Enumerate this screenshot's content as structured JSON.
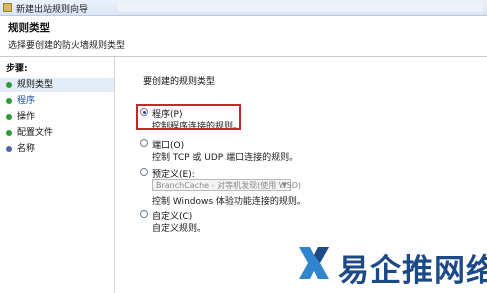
{
  "window": {
    "title": "新建出站规则向导"
  },
  "header": {
    "title": "规则类型",
    "subtitle": "选择要创建的防火墙规则类型"
  },
  "sidebar": {
    "steps_label": "步骤:",
    "items": [
      {
        "label": "规则类型"
      },
      {
        "label": "程序"
      },
      {
        "label": "操作"
      },
      {
        "label": "配置文件"
      },
      {
        "label": "名称"
      }
    ]
  },
  "main": {
    "prompt": "要创建的规则类型",
    "options": [
      {
        "label": "程序(P)",
        "description": "控制程序连接的规则。",
        "selected": true
      },
      {
        "label": "端口(O)",
        "description": "控制 TCP 或 UDP 端口连接的规则。",
        "selected": false
      },
      {
        "label": "预定义(E):",
        "description": "控制 Windows 体验功能连接的规则。",
        "selected": false
      },
      {
        "label": "自定义(C)",
        "description": "自定义规则。",
        "selected": false
      }
    ],
    "predefined_select": {
      "value": "BranchCache - 对等机发现(使用 WSD)"
    }
  },
  "watermark": {
    "text": "易企推网络"
  },
  "colors": {
    "accent": "#1d4a86",
    "highlight_border": "#c8252c",
    "step_done": "#2f9a38"
  }
}
